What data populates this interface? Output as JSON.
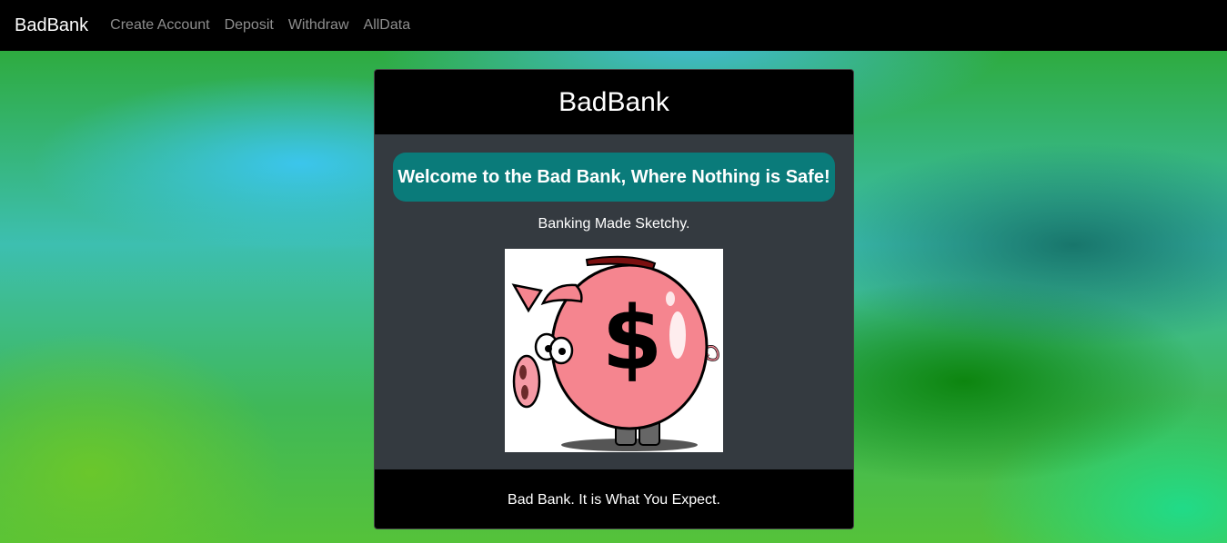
{
  "navbar": {
    "brand": "BadBank",
    "links": [
      "Create Account",
      "Deposit",
      "Withdraw",
      "AllData"
    ]
  },
  "card": {
    "header": "BadBank",
    "welcome": "Welcome to the Bad Bank, Where Nothing is Safe!",
    "tagline": "Banking Made Sketchy.",
    "image": "piggy-bank-dollar-illustration",
    "footer": "Bad Bank. It is What You Expect.",
    "welcome_color": "#0a7b7a"
  }
}
